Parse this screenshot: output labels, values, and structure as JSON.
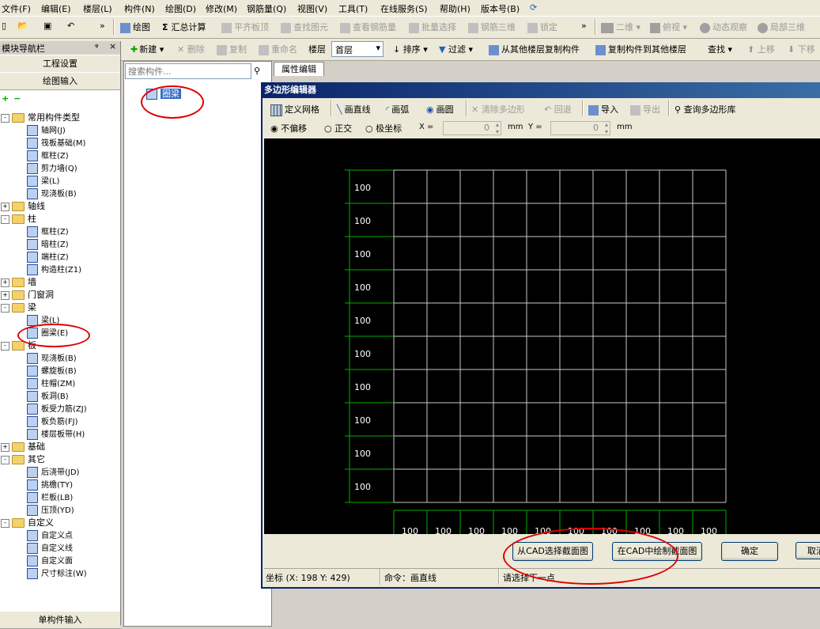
{
  "menu": [
    "文件(F)",
    "编辑(E)",
    "楼层(L)",
    "构件(N)",
    "绘图(D)",
    "修改(M)",
    "钢筋量(Q)",
    "视图(V)",
    "工具(T)",
    "在线服务(S)",
    "帮助(H)",
    "版本号(B)"
  ],
  "toolbar1": {
    "draw": "绘图",
    "sum_calc": "汇总计算",
    "flush_slab": "平齐板顶",
    "find_element": "查找图元",
    "view_rebar": "查看钢筋量",
    "batch_select": "批量选择",
    "rebar_3d": "钢筋三维",
    "lock": "锁定",
    "view_2d": "二维",
    "top_view": "俯视",
    "dynamic_view": "动态观察",
    "local_3d": "局部三维"
  },
  "toolbar2": {
    "new": "新建",
    "delete": "删除",
    "copy": "复制",
    "rename": "重命名",
    "floor_label": "楼层",
    "floor_value": "首层",
    "sort": "排序",
    "filter": "过滤",
    "copy_from_floor": "从其他楼层复制构件",
    "copy_to_floor": "复制构件到其他楼层",
    "find": "查找",
    "move_up": "上移",
    "move_down": "下移"
  },
  "nav": {
    "title": "模块导航栏",
    "pin": "ᵠ",
    "close": "×",
    "project_settings": "工程设置",
    "drawing_input": "绘图输入",
    "single_input": "单构件输入",
    "tree": [
      {
        "label": "常用构件类型",
        "type": "folder",
        "level": 0,
        "exp": "-"
      },
      {
        "label": "轴网(J)",
        "type": "leaf",
        "level": 1
      },
      {
        "label": "筏板基础(M)",
        "type": "leaf",
        "level": 1
      },
      {
        "label": "框柱(Z)",
        "type": "leaf",
        "level": 1
      },
      {
        "label": "剪力墙(Q)",
        "type": "leaf",
        "level": 1
      },
      {
        "label": "梁(L)",
        "type": "leaf",
        "level": 1
      },
      {
        "label": "现浇板(B)",
        "type": "leaf",
        "level": 1
      },
      {
        "label": "轴线",
        "type": "folder",
        "level": 0,
        "exp": "+"
      },
      {
        "label": "柱",
        "type": "folder",
        "level": 0,
        "exp": "-"
      },
      {
        "label": "框柱(Z)",
        "type": "leaf",
        "level": 1
      },
      {
        "label": "暗柱(Z)",
        "type": "leaf",
        "level": 1
      },
      {
        "label": "端柱(Z)",
        "type": "leaf",
        "level": 1
      },
      {
        "label": "构造柱(Z1)",
        "type": "leaf",
        "level": 1
      },
      {
        "label": "墙",
        "type": "folder",
        "level": 0,
        "exp": "+"
      },
      {
        "label": "门窗洞",
        "type": "folder",
        "level": 0,
        "exp": "+"
      },
      {
        "label": "梁",
        "type": "folder",
        "level": 0,
        "exp": "-"
      },
      {
        "label": "梁(L)",
        "type": "leaf",
        "level": 1
      },
      {
        "label": "圈梁(E)",
        "type": "leaf",
        "level": 1
      },
      {
        "label": "板",
        "type": "folder",
        "level": 0,
        "exp": "-"
      },
      {
        "label": "现浇板(B)",
        "type": "leaf",
        "level": 1
      },
      {
        "label": "螺旋板(B)",
        "type": "leaf",
        "level": 1
      },
      {
        "label": "柱帽(ZM)",
        "type": "leaf",
        "level": 1
      },
      {
        "label": "板洞(B)",
        "type": "leaf",
        "level": 1
      },
      {
        "label": "板受力筋(ZJ)",
        "type": "leaf",
        "level": 1
      },
      {
        "label": "板负筋(FJ)",
        "type": "leaf",
        "level": 1
      },
      {
        "label": "楼层板带(H)",
        "type": "leaf",
        "level": 1
      },
      {
        "label": "基础",
        "type": "folder",
        "level": 0,
        "exp": "+"
      },
      {
        "label": "其它",
        "type": "folder",
        "level": 0,
        "exp": "-"
      },
      {
        "label": "后浇带(JD)",
        "type": "leaf",
        "level": 1
      },
      {
        "label": "挑檐(TY)",
        "type": "leaf",
        "level": 1
      },
      {
        "label": "栏板(LB)",
        "type": "leaf",
        "level": 1
      },
      {
        "label": "压顶(YD)",
        "type": "leaf",
        "level": 1
      },
      {
        "label": "自定义",
        "type": "folder",
        "level": 0,
        "exp": "-"
      },
      {
        "label": "自定义点",
        "type": "leaf",
        "level": 1
      },
      {
        "label": "自定义线",
        "type": "leaf",
        "level": 1
      },
      {
        "label": "自定义面",
        "type": "leaf",
        "level": 1
      },
      {
        "label": "尺寸标注(W)",
        "type": "leaf",
        "level": 1
      }
    ]
  },
  "middle": {
    "search_placeholder": "搜索构件...",
    "element": "圈梁"
  },
  "tabs": {
    "properties": "属性编辑"
  },
  "dialog": {
    "title": "多边形编辑器",
    "define_grid": "定义网格",
    "draw_line": "画直线",
    "draw_arc": "画弧",
    "draw_circle": "画圆",
    "clear_polygon": "清除多边形",
    "undo": "回退",
    "import": "导入",
    "export": "导出",
    "query_library": "查询多边形库",
    "mode_no_offset": "不偏移",
    "mode_ortho": "正交",
    "mode_polar": "极坐标",
    "x_label": "X =",
    "x_value": "0",
    "x_unit": "mm",
    "y_label": "Y =",
    "y_value": "0",
    "y_unit": "mm",
    "grid_row_label": "100",
    "grid_col_label": "100",
    "select_from_cad": "从CAD选择截面图",
    "draw_in_cad": "在CAD中绘制截面图",
    "ok": "确定",
    "cancel": "取消",
    "status_coord": "坐标 (X: 198 Y: 429)",
    "status_cmd": "命令：画直线",
    "status_prompt": "请选择下一点"
  }
}
